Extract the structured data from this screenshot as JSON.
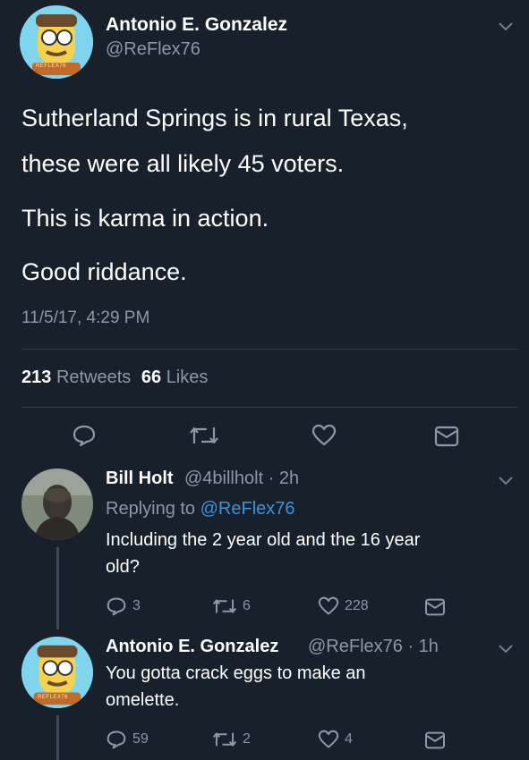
{
  "main_tweet": {
    "name": "Antonio E. Gonzalez",
    "handle": "@ReFlex76",
    "lines": [
      "Sutherland Springs is in rural Texas,",
      "these were all likely 45 voters.",
      "This is karma in action.",
      "Good riddance."
    ],
    "timestamp": "11/5/17, 4:29 PM",
    "retweets_count": "213",
    "retweets_label": "Retweets",
    "likes_count": "66",
    "likes_label": "Likes",
    "avatar_caption": "REFLEX76"
  },
  "replies": [
    {
      "name": "Bill Holt",
      "meta": "@4billholt · 2h",
      "replying_label": "Replying to",
      "replying_handle": "@ReFlex76",
      "text_lines": [
        "Including the 2 year old and the 16 year",
        "old?"
      ],
      "replies_count": "3",
      "retweets_count": "6",
      "likes_count": "228"
    },
    {
      "name": "Antonio E. Gonzalez",
      "meta": "@ReFlex76 · 1h",
      "text_lines": [
        "You gotta crack eggs to make an",
        "omelette."
      ],
      "replies_count": "59",
      "retweets_count": "2",
      "likes_count": "4",
      "avatar_caption": "REFLEX76"
    }
  ],
  "colors": {
    "background": "#18202b",
    "link": "#3b94d9",
    "muted": "#8a98a8",
    "divider": "#2f3b48"
  }
}
